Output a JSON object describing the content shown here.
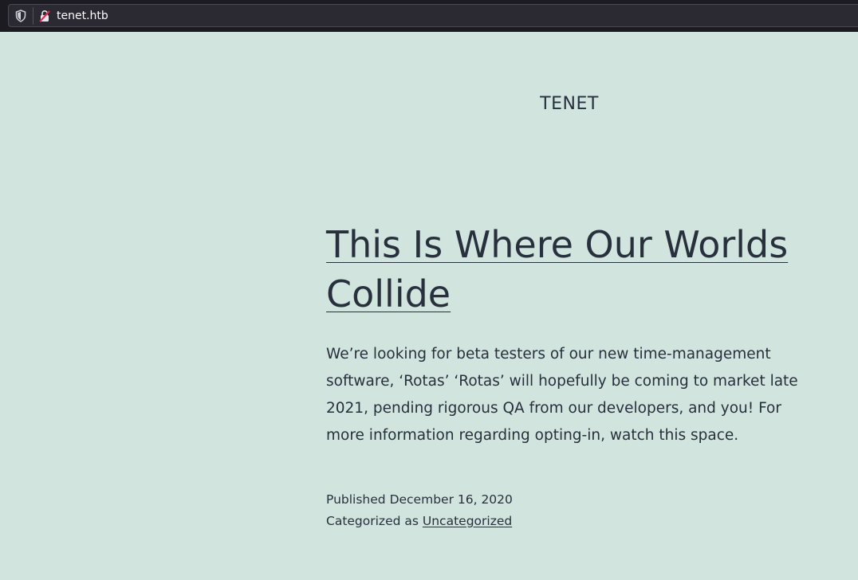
{
  "browser": {
    "url": "tenet.htb",
    "shield_icon": "shield-icon",
    "lock_icon": "insecure-lock-icon"
  },
  "site": {
    "title": "TENET"
  },
  "post": {
    "title": "This Is Where Our Worlds Collide",
    "content": "We’re looking for beta testers of our new time-management software, ‘Rotas’ ‘Rotas’ will hopefully be coming to market late 2021, pending rigorous QA from our developers, and you! For more information regarding opting-in, watch this space.",
    "published_label": "Published",
    "published_date": "December 16, 2020",
    "categorized_label": "Categorized as",
    "category": "Uncategorized"
  }
}
